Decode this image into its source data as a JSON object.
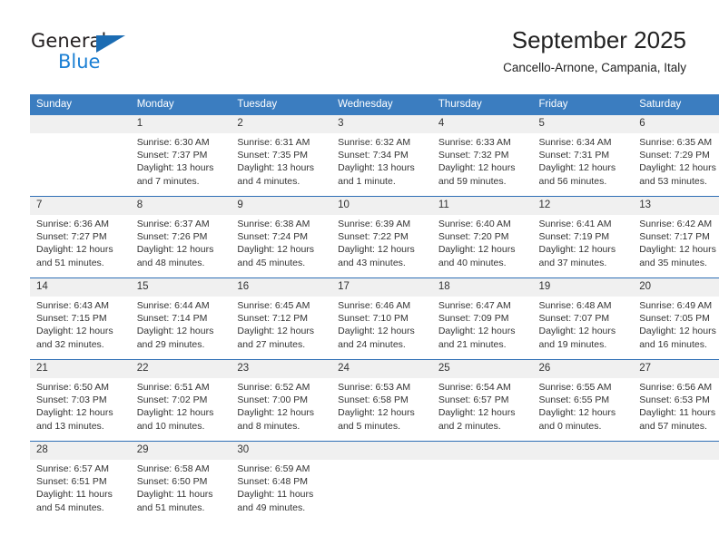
{
  "brand": {
    "name_part1": "General",
    "name_part2": "Blue",
    "triangle_color": "#1b6cb3",
    "blue_color": "#1b7fd4"
  },
  "header": {
    "title": "September 2025",
    "subtitle": "Cancello-Arnone, Campania, Italy"
  },
  "calendar": {
    "header_bg": "#3b7dc0",
    "daynum_bg": "#f0f0f0",
    "row_divider": "#2f6fb5",
    "weekdays": [
      "Sunday",
      "Monday",
      "Tuesday",
      "Wednesday",
      "Thursday",
      "Friday",
      "Saturday"
    ],
    "weeks": [
      [
        {
          "day": "",
          "sunrise": "",
          "sunset": "",
          "daylight1": "",
          "daylight2": ""
        },
        {
          "day": "1",
          "sunrise": "Sunrise: 6:30 AM",
          "sunset": "Sunset: 7:37 PM",
          "daylight1": "Daylight: 13 hours",
          "daylight2": "and 7 minutes."
        },
        {
          "day": "2",
          "sunrise": "Sunrise: 6:31 AM",
          "sunset": "Sunset: 7:35 PM",
          "daylight1": "Daylight: 13 hours",
          "daylight2": "and 4 minutes."
        },
        {
          "day": "3",
          "sunrise": "Sunrise: 6:32 AM",
          "sunset": "Sunset: 7:34 PM",
          "daylight1": "Daylight: 13 hours",
          "daylight2": "and 1 minute."
        },
        {
          "day": "4",
          "sunrise": "Sunrise: 6:33 AM",
          "sunset": "Sunset: 7:32 PM",
          "daylight1": "Daylight: 12 hours",
          "daylight2": "and 59 minutes."
        },
        {
          "day": "5",
          "sunrise": "Sunrise: 6:34 AM",
          "sunset": "Sunset: 7:31 PM",
          "daylight1": "Daylight: 12 hours",
          "daylight2": "and 56 minutes."
        },
        {
          "day": "6",
          "sunrise": "Sunrise: 6:35 AM",
          "sunset": "Sunset: 7:29 PM",
          "daylight1": "Daylight: 12 hours",
          "daylight2": "and 53 minutes."
        }
      ],
      [
        {
          "day": "7",
          "sunrise": "Sunrise: 6:36 AM",
          "sunset": "Sunset: 7:27 PM",
          "daylight1": "Daylight: 12 hours",
          "daylight2": "and 51 minutes."
        },
        {
          "day": "8",
          "sunrise": "Sunrise: 6:37 AM",
          "sunset": "Sunset: 7:26 PM",
          "daylight1": "Daylight: 12 hours",
          "daylight2": "and 48 minutes."
        },
        {
          "day": "9",
          "sunrise": "Sunrise: 6:38 AM",
          "sunset": "Sunset: 7:24 PM",
          "daylight1": "Daylight: 12 hours",
          "daylight2": "and 45 minutes."
        },
        {
          "day": "10",
          "sunrise": "Sunrise: 6:39 AM",
          "sunset": "Sunset: 7:22 PM",
          "daylight1": "Daylight: 12 hours",
          "daylight2": "and 43 minutes."
        },
        {
          "day": "11",
          "sunrise": "Sunrise: 6:40 AM",
          "sunset": "Sunset: 7:20 PM",
          "daylight1": "Daylight: 12 hours",
          "daylight2": "and 40 minutes."
        },
        {
          "day": "12",
          "sunrise": "Sunrise: 6:41 AM",
          "sunset": "Sunset: 7:19 PM",
          "daylight1": "Daylight: 12 hours",
          "daylight2": "and 37 minutes."
        },
        {
          "day": "13",
          "sunrise": "Sunrise: 6:42 AM",
          "sunset": "Sunset: 7:17 PM",
          "daylight1": "Daylight: 12 hours",
          "daylight2": "and 35 minutes."
        }
      ],
      [
        {
          "day": "14",
          "sunrise": "Sunrise: 6:43 AM",
          "sunset": "Sunset: 7:15 PM",
          "daylight1": "Daylight: 12 hours",
          "daylight2": "and 32 minutes."
        },
        {
          "day": "15",
          "sunrise": "Sunrise: 6:44 AM",
          "sunset": "Sunset: 7:14 PM",
          "daylight1": "Daylight: 12 hours",
          "daylight2": "and 29 minutes."
        },
        {
          "day": "16",
          "sunrise": "Sunrise: 6:45 AM",
          "sunset": "Sunset: 7:12 PM",
          "daylight1": "Daylight: 12 hours",
          "daylight2": "and 27 minutes."
        },
        {
          "day": "17",
          "sunrise": "Sunrise: 6:46 AM",
          "sunset": "Sunset: 7:10 PM",
          "daylight1": "Daylight: 12 hours",
          "daylight2": "and 24 minutes."
        },
        {
          "day": "18",
          "sunrise": "Sunrise: 6:47 AM",
          "sunset": "Sunset: 7:09 PM",
          "daylight1": "Daylight: 12 hours",
          "daylight2": "and 21 minutes."
        },
        {
          "day": "19",
          "sunrise": "Sunrise: 6:48 AM",
          "sunset": "Sunset: 7:07 PM",
          "daylight1": "Daylight: 12 hours",
          "daylight2": "and 19 minutes."
        },
        {
          "day": "20",
          "sunrise": "Sunrise: 6:49 AM",
          "sunset": "Sunset: 7:05 PM",
          "daylight1": "Daylight: 12 hours",
          "daylight2": "and 16 minutes."
        }
      ],
      [
        {
          "day": "21",
          "sunrise": "Sunrise: 6:50 AM",
          "sunset": "Sunset: 7:03 PM",
          "daylight1": "Daylight: 12 hours",
          "daylight2": "and 13 minutes."
        },
        {
          "day": "22",
          "sunrise": "Sunrise: 6:51 AM",
          "sunset": "Sunset: 7:02 PM",
          "daylight1": "Daylight: 12 hours",
          "daylight2": "and 10 minutes."
        },
        {
          "day": "23",
          "sunrise": "Sunrise: 6:52 AM",
          "sunset": "Sunset: 7:00 PM",
          "daylight1": "Daylight: 12 hours",
          "daylight2": "and 8 minutes."
        },
        {
          "day": "24",
          "sunrise": "Sunrise: 6:53 AM",
          "sunset": "Sunset: 6:58 PM",
          "daylight1": "Daylight: 12 hours",
          "daylight2": "and 5 minutes."
        },
        {
          "day": "25",
          "sunrise": "Sunrise: 6:54 AM",
          "sunset": "Sunset: 6:57 PM",
          "daylight1": "Daylight: 12 hours",
          "daylight2": "and 2 minutes."
        },
        {
          "day": "26",
          "sunrise": "Sunrise: 6:55 AM",
          "sunset": "Sunset: 6:55 PM",
          "daylight1": "Daylight: 12 hours",
          "daylight2": "and 0 minutes."
        },
        {
          "day": "27",
          "sunrise": "Sunrise: 6:56 AM",
          "sunset": "Sunset: 6:53 PM",
          "daylight1": "Daylight: 11 hours",
          "daylight2": "and 57 minutes."
        }
      ],
      [
        {
          "day": "28",
          "sunrise": "Sunrise: 6:57 AM",
          "sunset": "Sunset: 6:51 PM",
          "daylight1": "Daylight: 11 hours",
          "daylight2": "and 54 minutes."
        },
        {
          "day": "29",
          "sunrise": "Sunrise: 6:58 AM",
          "sunset": "Sunset: 6:50 PM",
          "daylight1": "Daylight: 11 hours",
          "daylight2": "and 51 minutes."
        },
        {
          "day": "30",
          "sunrise": "Sunrise: 6:59 AM",
          "sunset": "Sunset: 6:48 PM",
          "daylight1": "Daylight: 11 hours",
          "daylight2": "and 49 minutes."
        },
        {
          "day": "",
          "sunrise": "",
          "sunset": "",
          "daylight1": "",
          "daylight2": ""
        },
        {
          "day": "",
          "sunrise": "",
          "sunset": "",
          "daylight1": "",
          "daylight2": ""
        },
        {
          "day": "",
          "sunrise": "",
          "sunset": "",
          "daylight1": "",
          "daylight2": ""
        },
        {
          "day": "",
          "sunrise": "",
          "sunset": "",
          "daylight1": "",
          "daylight2": ""
        }
      ]
    ]
  }
}
